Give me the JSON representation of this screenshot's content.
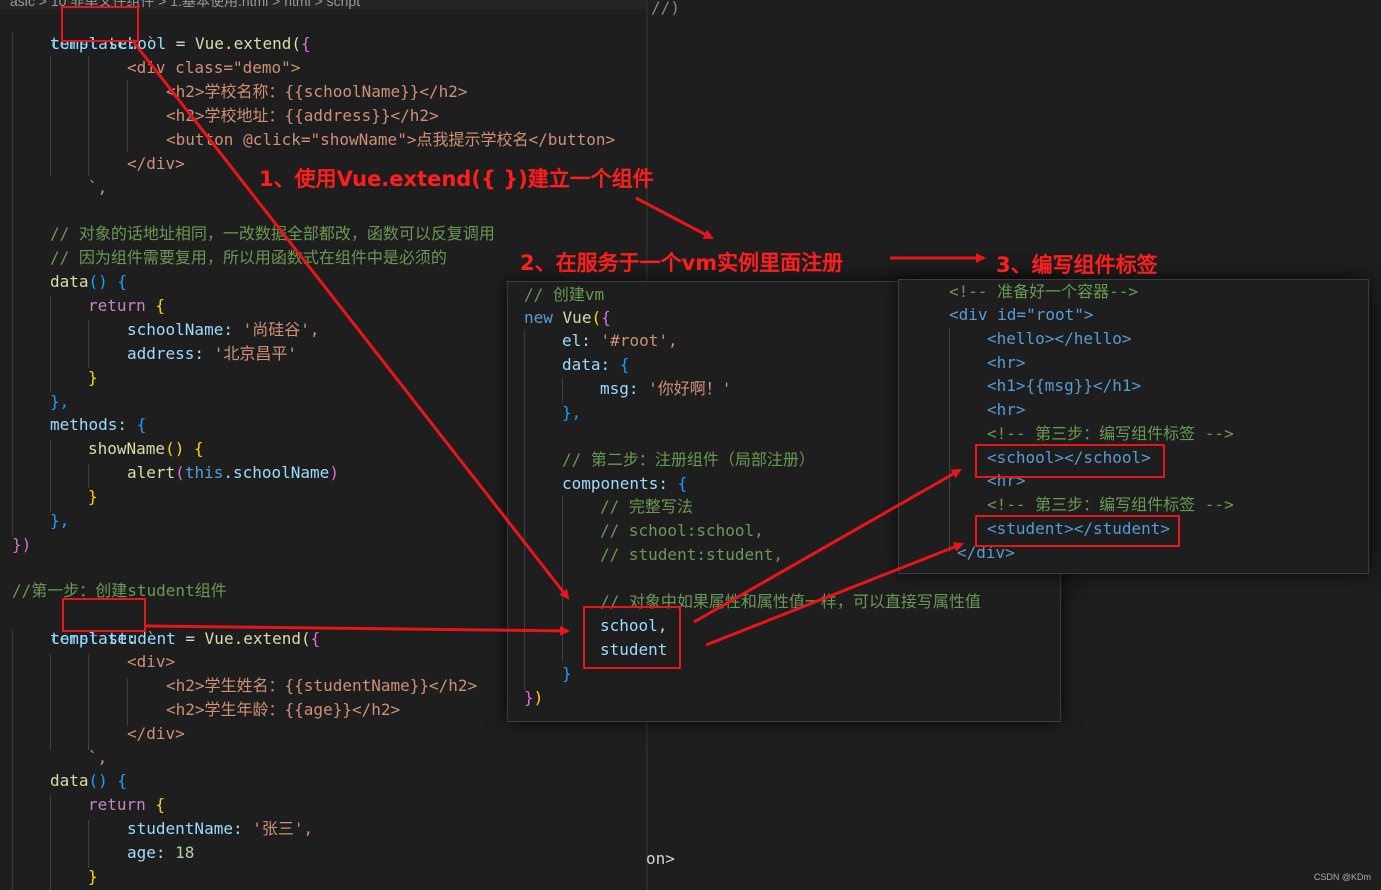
{
  "editor": {
    "breadcrumb": "asic  >  10 非单文件组件  >  1.基本使用.html  >  html  >  script",
    "left_code": {
      "school_const": "const ",
      "school_name": "school",
      "school_assign": " = ",
      "extend_call": "Vue.extend(",
      "template_key": "template:",
      "div_demo_open": "<div class=\"demo\">",
      "h2_school_name": "<h2>学校名称：{{schoolName}}</h2>",
      "h2_address": "<h2>学校地址：{{address}}</h2>",
      "button_line": "<button @click=\"showName\">点我提示学校名</button>",
      "div_close": "</div>",
      "template_end": "`,",
      "comment_1": "// 对象的话地址相同，一改数据全部都改，函数可以反复调用",
      "comment_2": "// 因为组件需要复用，所以用函数式在组件中是必须的",
      "data_fn": "data",
      "return_kw": "return",
      "school_name_key": "schoolName:",
      "school_name_val": "'尚硅谷',",
      "address_key": "address:",
      "address_val": "'北京昌平'",
      "close_brace": "}",
      "close_brace_comma": "},",
      "methods_key": "methods:",
      "show_name_fn": "showName",
      "alert_fn": "alert",
      "this_kw": "this",
      "school_name_prop": ".schoolName",
      "close_all": "})",
      "comment_step1": "//第一步：创建student组件",
      "student_const": "const ",
      "student_name": "student",
      "div_open": "<div>",
      "h2_student_name": "<h2>学生姓名：{{studentName}}</h2>",
      "h2_age": "<h2>学生年龄：{{age}}</h2>",
      "student_name_key": "studentName:",
      "student_name_val": "'张三',",
      "age_key": "age:",
      "age_val": "18"
    },
    "right_fragments": {
      "top": "//)",
      "bottom": "on>"
    }
  },
  "vm_panel": {
    "comment_create": "// 创建vm",
    "new_kw": "new",
    "vue_cls": "Vue",
    "el_key": "el:",
    "el_val": "'#root',",
    "data_key": "data:",
    "msg_key": "msg:",
    "msg_val": "'你好啊！'",
    "close_brace_comma": "},",
    "comment_step2": "// 第二步：注册组件（局部注册）",
    "components_key": "components:",
    "comment_full": "// 完整写法",
    "comment_school": "// school:school,",
    "comment_student": "// student:student,",
    "comment_shorthand": "// 对象中如果属性和属性值一样，可以直接写属性值",
    "school_short": "school,",
    "student_short": "student",
    "close_brace": "}",
    "close_all": "})"
  },
  "html_panel": {
    "comment_container": "<!-- 准备好一个容器-->",
    "div_root": "<div id=\"root\">",
    "hello_tag": "<hello></hello>",
    "hr_tag": "<hr>",
    "h1_msg": "<h1>{{msg}}</h1>",
    "comment_step3": "<!-- 第三步：编写组件标签 -->",
    "school_tag": "<school></school>",
    "student_tag": "<student></student>",
    "div_close": "</div>"
  },
  "annotations": {
    "step1": "1、使用Vue.extend({ })建立一个组件",
    "step2": "2、在服务于一个vm实例里面注册",
    "step3": "3、编写组件标签"
  },
  "watermark": "CSDN @KDm",
  "colors": {
    "annotation_red": "#e8161b",
    "keyword": "#569cd6",
    "string": "#ce9178",
    "comment": "#6a9955"
  }
}
